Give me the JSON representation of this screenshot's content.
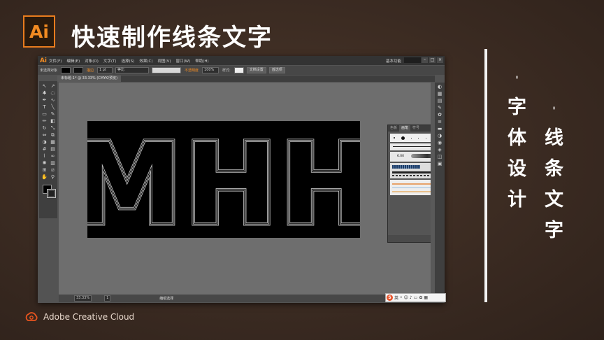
{
  "slide": {
    "title": "快速制作线条文字",
    "logo_text": "Ai",
    "col_left": [
      "'",
      "字",
      "体",
      "设",
      "计"
    ],
    "col_right": [
      "'",
      "线",
      "条",
      "文",
      "字"
    ],
    "footer": "Adobe Creative Cloud"
  },
  "app": {
    "icon": "Ai",
    "menus": [
      "文件(F)",
      "编辑(E)",
      "对象(O)",
      "文字(T)",
      "选择(S)",
      "效果(C)",
      "视图(V)",
      "窗口(W)",
      "帮助(H)"
    ],
    "workspace": "基本功能",
    "window_buttons": [
      "–",
      "□",
      "×"
    ]
  },
  "control_bar": {
    "selection_status": "未选择对象",
    "stroke_label": "描边",
    "stroke_weight": "1 pt",
    "stroke_profile": "等比",
    "opacity_label": "不透明度",
    "opacity_value": "100%",
    "style_label": "样式:",
    "doc_setup": "文档设置",
    "prefs": "首选项"
  },
  "document_tab": "未标题-1* @ 33.33% (CMYK/预览)",
  "artwork_text": "MHH",
  "status_bar": {
    "zoom": "33.33%",
    "page": "1",
    "tool_name": "编组选择"
  },
  "brush_panel": {
    "tabs": [
      "色板",
      "画笔",
      "符号"
    ],
    "basic_label": "基本",
    "size_label": "6.00"
  },
  "ime": {
    "logo": "S",
    "lang": "英"
  },
  "colors": {
    "accent": "#f28b22",
    "bg": "#3a2a22",
    "window": "#535353",
    "canvas": "#6e6e6e"
  }
}
